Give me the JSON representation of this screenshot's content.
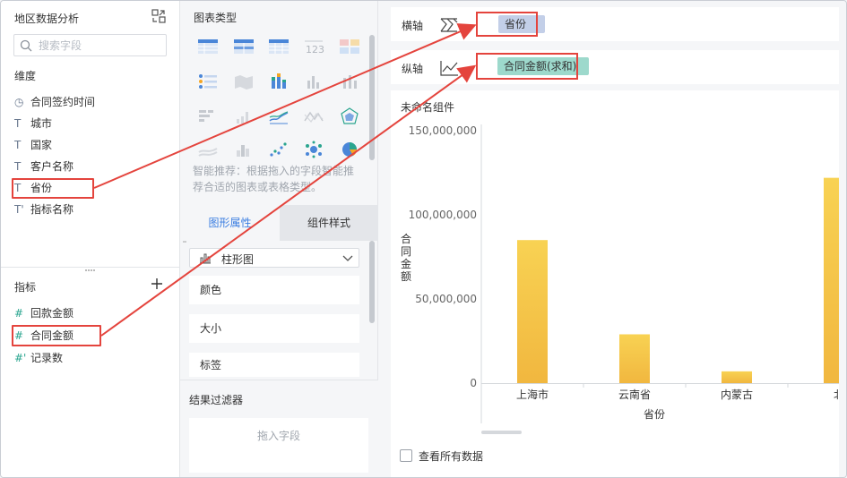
{
  "left_panel": {
    "dataset_title": "地区数据分析",
    "search_placeholder": "搜索字段",
    "dimensions_label": "维度",
    "dimensions": [
      {
        "label": "合同签约时间",
        "icon": "clock-icon",
        "glyph": "◷"
      },
      {
        "label": "城市",
        "icon": "text-type-icon",
        "glyph": "T"
      },
      {
        "label": "国家",
        "icon": "text-type-icon",
        "glyph": "T"
      },
      {
        "label": "客户名称",
        "icon": "text-type-icon",
        "glyph": "T"
      },
      {
        "label": "省份",
        "icon": "text-type-icon",
        "glyph": "T"
      },
      {
        "label": "指标名称",
        "icon": "text-type-icon",
        "glyph": "T'"
      }
    ],
    "measures_label": "指标",
    "measures": [
      {
        "label": "回款金额",
        "icon": "number-type-icon",
        "glyph": "#"
      },
      {
        "label": "合同金额",
        "icon": "number-type-icon",
        "glyph": "#"
      },
      {
        "label": "记录数",
        "icon": "number-type-icon",
        "glyph": "#'"
      }
    ]
  },
  "middle_panel": {
    "chart_type_title": "图表类型",
    "smart_recommend": "智能推荐：根据拖入的字段智能推荐合适的图表或表格类型。",
    "tabs": [
      "图形属性",
      "组件样式"
    ],
    "chart_select": "柱形图",
    "props": [
      "颜色",
      "大小",
      "标签"
    ],
    "filter_title": "结果过滤器",
    "filter_drop": "拖入字段"
  },
  "right_panel": {
    "x_axis_label": "横轴",
    "x_axis_field": "省份",
    "y_axis_label": "纵轴",
    "y_axis_field": "合同金额(求和)",
    "component_title": "未命名组件",
    "show_all": "查看所有数据"
  },
  "colors": {
    "bar": "#f5c040",
    "highlight": "#e4443d",
    "accent": "#3a7de1",
    "pill_x": "#c3cfe8",
    "pill_y": "#9dd9cc"
  },
  "chart_data": {
    "type": "bar",
    "categories": [
      "上海市",
      "云南省",
      "内蒙古",
      "北"
    ],
    "values": [
      85000000,
      29000000,
      7000000,
      122000000
    ],
    "xlabel": "省份",
    "ylabel": "合同金额",
    "ylim": [
      0,
      150000000
    ],
    "yticks": [
      "0",
      "50,000,000",
      "100,000,000",
      "150,000,000"
    ],
    "grid": false,
    "legend": "none"
  }
}
